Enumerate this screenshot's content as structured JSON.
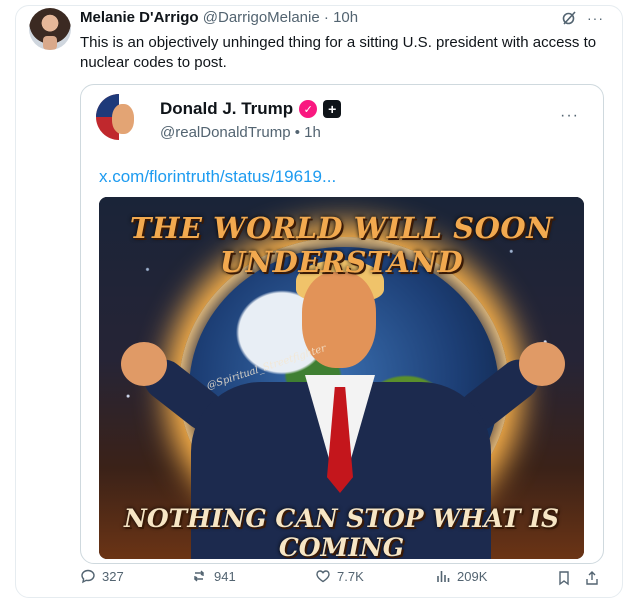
{
  "tweet": {
    "author_name": "Melanie D'Arrigo",
    "author_handle": "@DarrigoMelanie",
    "time": "10h",
    "text": "This is an objectively unhinged thing for a sitting U.S. president with access to nuclear codes to post."
  },
  "quoted": {
    "author_name": "Donald J. Trump",
    "author_handle": "@realDonaldTrump",
    "time": "1h",
    "link": "x.com/florintruth/status/19619...",
    "media": {
      "headline_top": "THE WORLD WILL SOON UNDERSTAND",
      "headline_bottom": "NOTHING CAN STOP WHAT IS COMING",
      "signature": "@Spiritual_Streetfighter"
    }
  },
  "actions": {
    "replies": "327",
    "reposts": "941",
    "likes": "7.7K",
    "views": "209K"
  },
  "colors": {
    "link": "#1d9bf0",
    "secondary_text": "#536471",
    "verified_badge": "#f91880"
  },
  "icons": [
    "grok-icon",
    "more-icon",
    "reply-icon",
    "repost-icon",
    "like-icon",
    "views-icon",
    "bookmark-icon",
    "share-icon"
  ]
}
